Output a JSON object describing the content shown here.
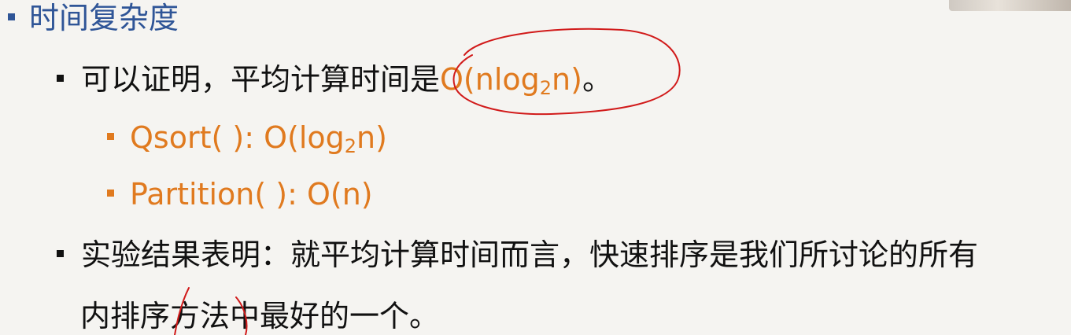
{
  "heading": "时间复杂度",
  "point1": {
    "prefix": "可以证明，平均计算时间是",
    "complexity_main": "O(nlog",
    "complexity_sub": "2",
    "complexity_tail": "n)",
    "suffix": "。"
  },
  "sub1": {
    "main": "Qsort( ): O(log",
    "sub": "2",
    "tail": "n)"
  },
  "sub2": {
    "text": "Partition( ): O(n)"
  },
  "point2": {
    "line1": "实验结果表明：就平均计算时间而言，快速排序是我们所讨论的所有",
    "line2": "内排序方法中最好的一个。"
  },
  "colors": {
    "heading": "#2f5597",
    "accent": "#e07a1f",
    "annotation": "#d11a1a",
    "text": "#111111"
  }
}
